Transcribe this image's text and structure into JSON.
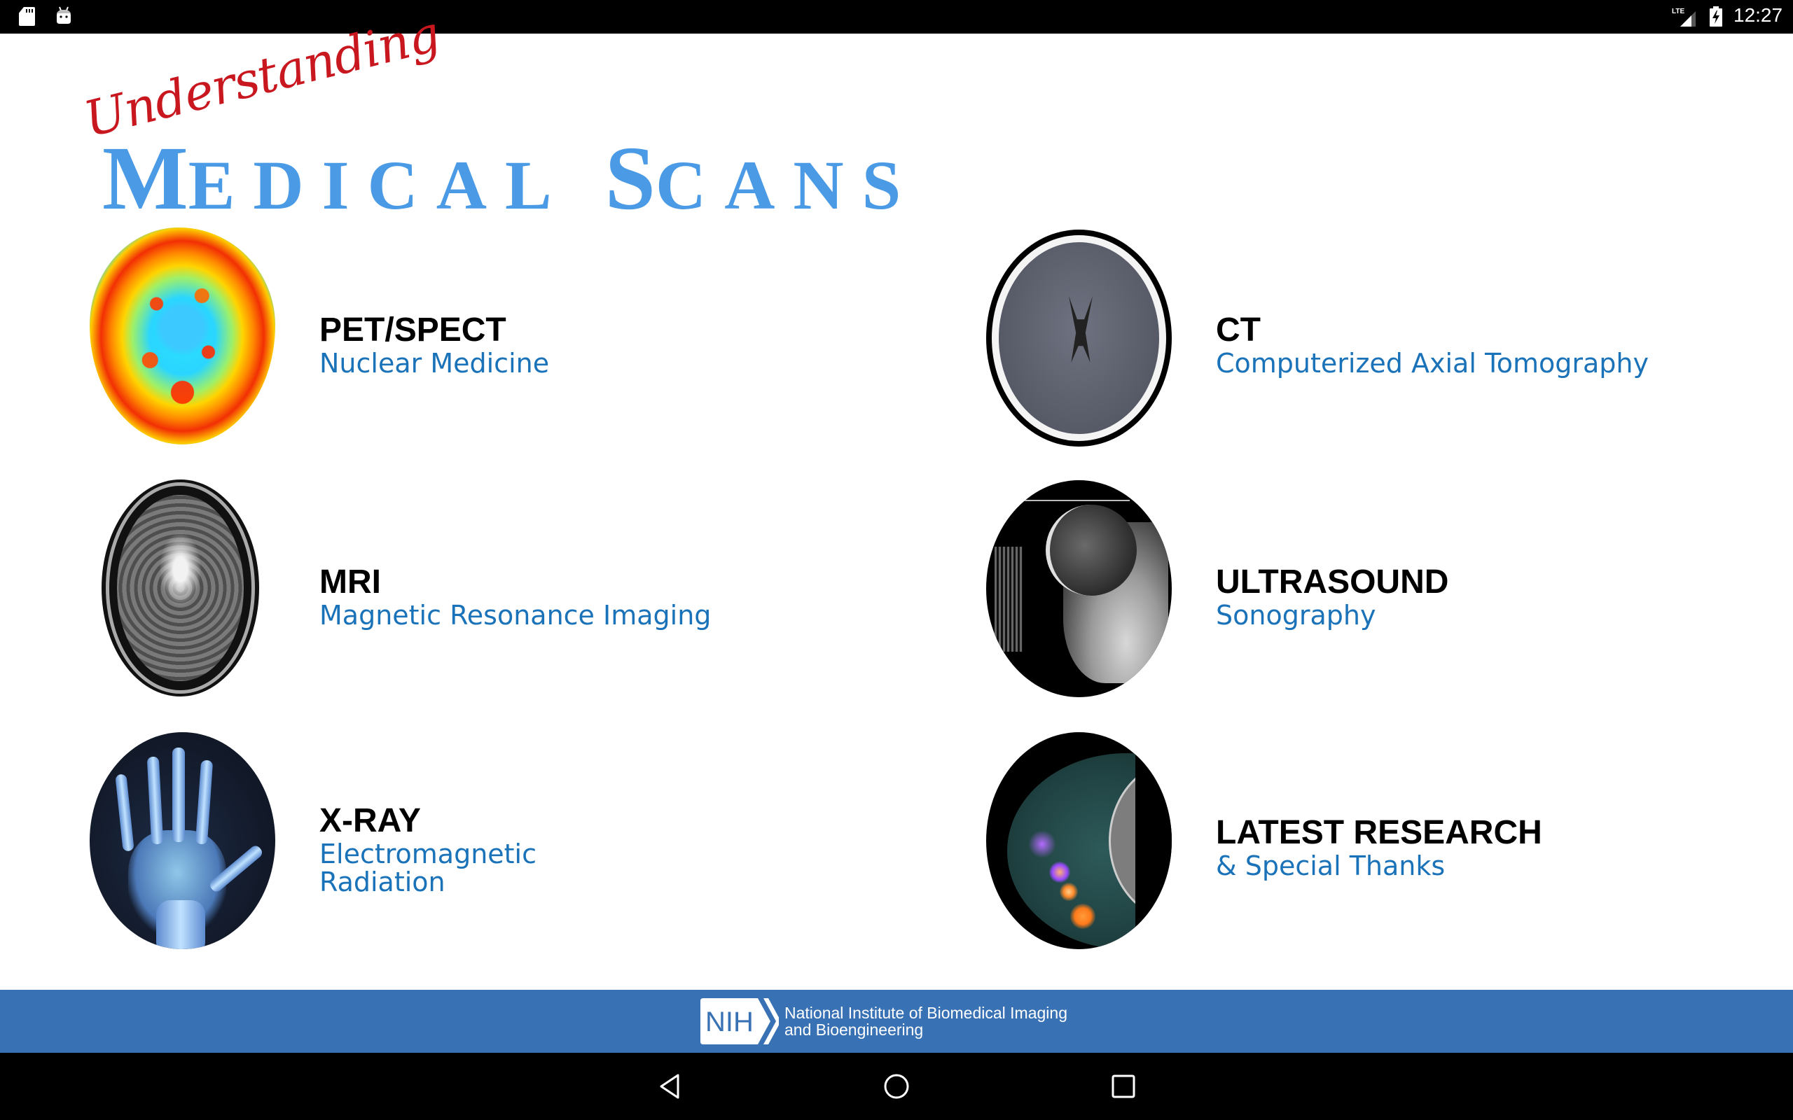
{
  "status_bar": {
    "left_icons": [
      "sd-card-icon",
      "android-debug-icon"
    ],
    "right_icons": [
      "lte-signal-icon",
      "battery-charging-icon"
    ],
    "network_label": "LTE",
    "time": "12:27"
  },
  "header": {
    "script_word": "Understanding",
    "title_word_1_initial": "M",
    "title_word_1_rest": "EDICAL",
    "title_word_2_initial": "S",
    "title_word_2_rest": "CANS",
    "colors": {
      "script": "#c8171e",
      "title": "#4a9ae6"
    }
  },
  "scan_items": [
    {
      "id": "pet-spect",
      "title": "PET/SPECT",
      "subtitle": "Nuclear Medicine",
      "thumbnail": "pet-brain-scan"
    },
    {
      "id": "ct",
      "title": "CT",
      "subtitle": "Computerized Axial Tomography",
      "thumbnail": "ct-brain-scan"
    },
    {
      "id": "mri",
      "title": "MRI",
      "subtitle": "Magnetic Resonance Imaging",
      "thumbnail": "mri-brain-scan"
    },
    {
      "id": "ultrasound",
      "title": "ULTRASOUND",
      "subtitle": "Sonography",
      "thumbnail": "fetal-ultrasound"
    },
    {
      "id": "x-ray",
      "title": "X-RAY",
      "subtitle": "Electromagnetic Radiation",
      "thumbnail": "hand-xray"
    },
    {
      "id": "latest-research",
      "title": "LATEST RESEARCH",
      "subtitle": "& Special Thanks",
      "thumbnail": "breast-pet-scan"
    }
  ],
  "colors": {
    "item_title": "#000000",
    "item_subtitle": "#1a72b9",
    "footer_bg": "#3871b4"
  },
  "footer": {
    "logo_text": "NIH",
    "org_line_1": "National Institute of Biomedical Imaging",
    "org_line_2": "and Bioengineering"
  },
  "nav_bar": {
    "buttons": [
      "back-icon",
      "home-icon",
      "recents-icon"
    ]
  }
}
